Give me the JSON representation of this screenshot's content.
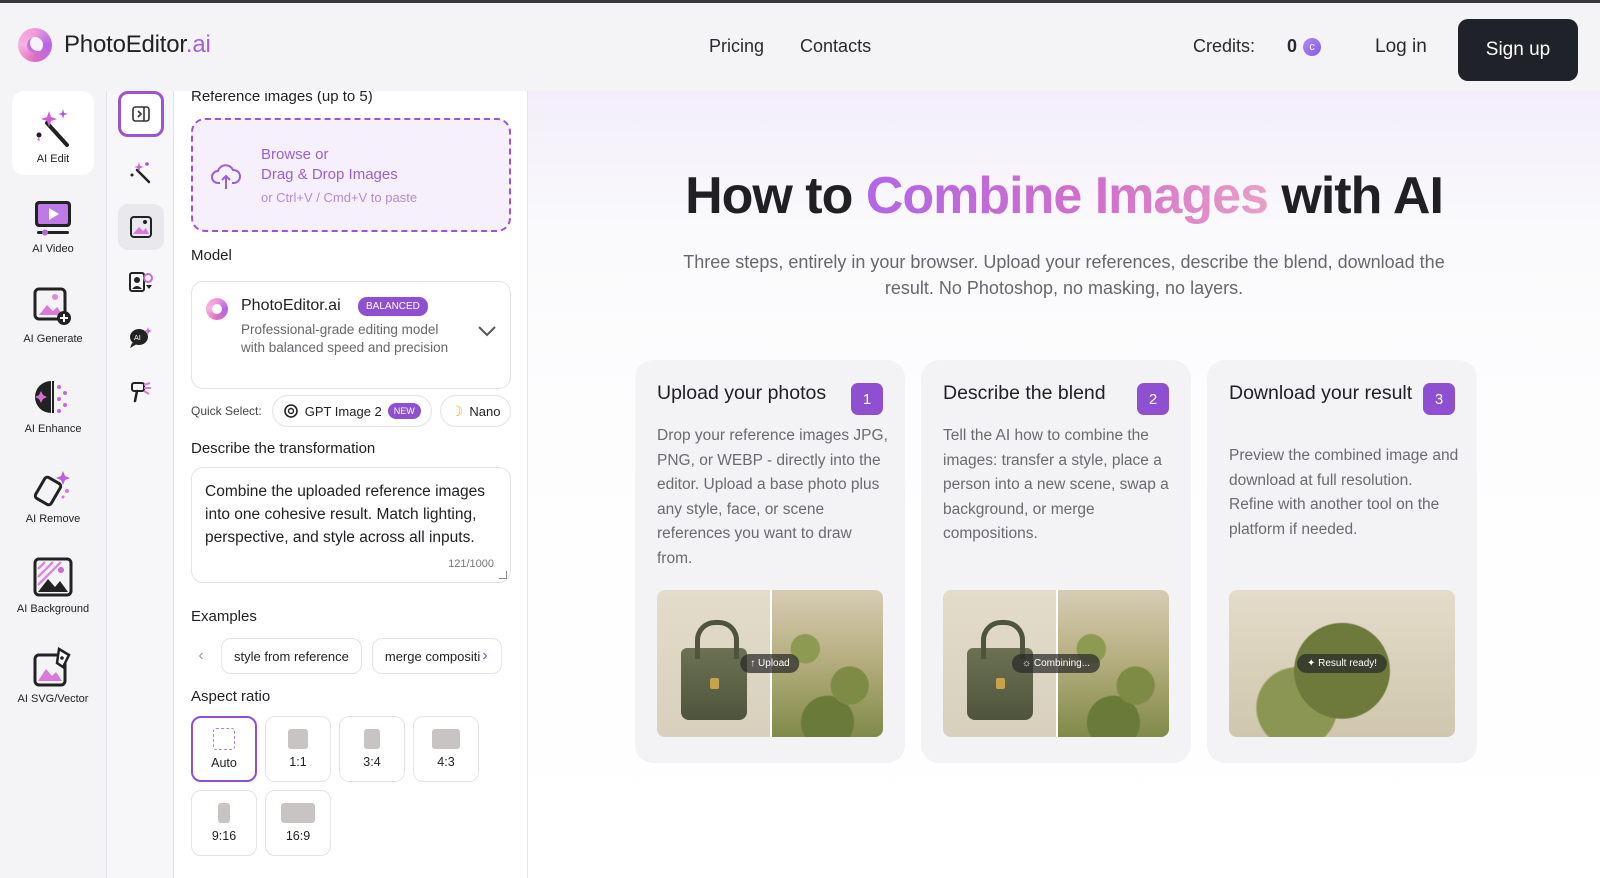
{
  "brand": {
    "name": "PhotoEditor",
    "suffix": ".ai"
  },
  "nav": {
    "pricing": "Pricing",
    "contacts": "Contacts"
  },
  "account": {
    "credits_label": "Credits:",
    "credits_value": "0",
    "coin_symbol": "c",
    "login": "Log in",
    "signup": "Sign up"
  },
  "rail": [
    {
      "label": "AI Edit",
      "icon": "magic-wand-icon",
      "active": true
    },
    {
      "label": "AI Video",
      "icon": "video-play-icon"
    },
    {
      "label": "AI Generate",
      "icon": "image-plus-icon"
    },
    {
      "label": "AI Enhance",
      "icon": "enhance-sparkle-icon"
    },
    {
      "label": "AI Remove",
      "icon": "eraser-icon"
    },
    {
      "label": "AI Background",
      "icon": "background-image-icon"
    },
    {
      "label": "AI SVG/Vector",
      "icon": "vector-pen-icon"
    }
  ],
  "panel": {
    "reference_label": "Reference images (up to 5)",
    "drop_line1": "Browse or",
    "drop_line2": "Drag & Drop Images",
    "drop_hint": "or Ctrl+V / Cmd+V to paste",
    "model_label": "Model",
    "model": {
      "name": "PhotoEditor.ai",
      "badge": "BALANCED",
      "description": "Professional-grade editing model with balanced speed and precision"
    },
    "quick_select_label": "Quick Select:",
    "quick_select": [
      {
        "label": "GPT Image 2",
        "badge": "NEW"
      },
      {
        "label": "Nano"
      }
    ],
    "describe_label": "Describe the transformation",
    "prompt_text": "Combine the uploaded reference images into one cohesive result. Match lighting, perspective, and style across all inputs.",
    "prompt_counter": "121/1000",
    "examples_label": "Examples",
    "examples": [
      "style from reference",
      "merge compositi"
    ],
    "aspect_label": "Aspect ratio",
    "aspect_ratios": [
      {
        "label": "Auto",
        "selected": true
      },
      {
        "label": "1:1"
      },
      {
        "label": "3:4"
      },
      {
        "label": "4:3"
      },
      {
        "label": "9:16"
      },
      {
        "label": "16:9"
      }
    ]
  },
  "main": {
    "title_pre": "How to ",
    "title_highlight": "Combine Images",
    "title_post": " with AI",
    "subtitle": "Three steps, entirely in your browser. Upload your references, describe the blend, download the result. No Photoshop, no masking, no layers.",
    "steps": [
      {
        "title": "Upload your photos",
        "number": "1",
        "body": "Drop your reference images JPG, PNG, or WEBP - directly into the editor. Upload a base photo plus any style, face, or scene references you want to draw from.",
        "overlay": "↑ Upload"
      },
      {
        "title": "Describe the blend",
        "number": "2",
        "body": "Tell the AI how to combine the images: transfer a style, place a person into a new scene, swap a background, or merge compositions.",
        "overlay": "☼ Combining..."
      },
      {
        "title": "Download your result",
        "number": "3",
        "body": "Preview the combined image and download at full resolution. Refine with another tool on the platform if needed.",
        "overlay": "✦ Result ready!"
      }
    ]
  },
  "colors": {
    "accent": "#8e4fd0",
    "dark_button": "#1f2228"
  }
}
